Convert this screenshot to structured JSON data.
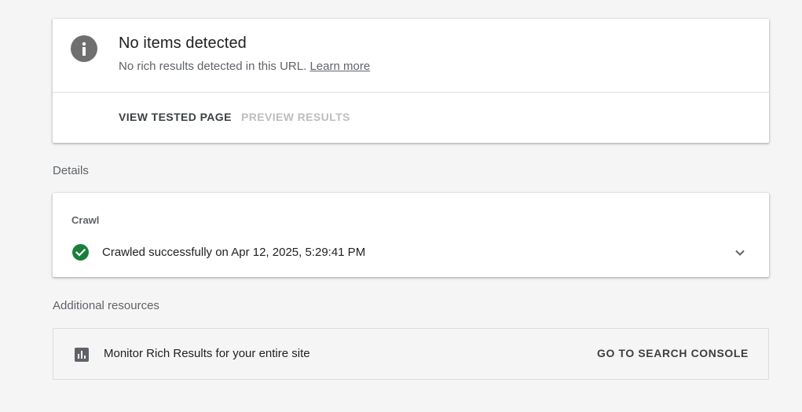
{
  "summary": {
    "icon": "info-icon",
    "title": "No items detected",
    "subtitle": "No rich results detected in this URL.",
    "learn_more": "Learn more",
    "actions": {
      "view_tested_page": "VIEW TESTED PAGE",
      "preview_results": "PREVIEW RESULTS"
    }
  },
  "details": {
    "label": "Details",
    "crawl": {
      "heading": "Crawl",
      "status_icon": "check-circle-icon",
      "status_color": "#188038",
      "status": "Crawled successfully on Apr 12, 2025, 5:29:41 PM"
    }
  },
  "additional_resources": {
    "label": "Additional resources",
    "icon": "bar-chart-icon",
    "text": "Monitor Rich Results for your entire site",
    "action": "GO TO SEARCH CONSOLE"
  }
}
